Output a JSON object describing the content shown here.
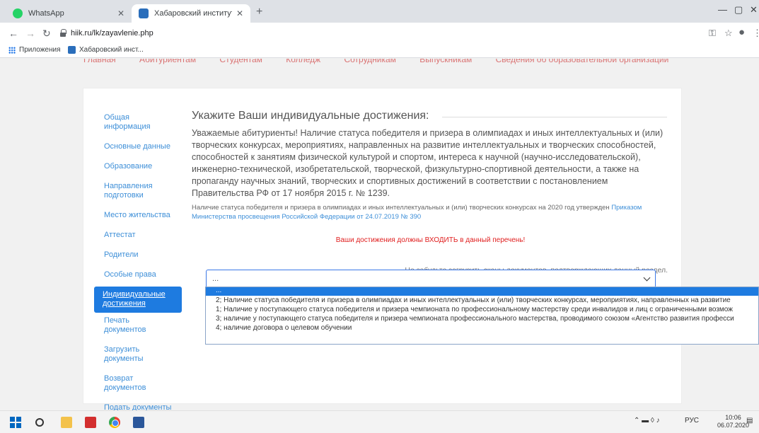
{
  "browser": {
    "tabs": [
      {
        "title": "WhatsApp",
        "favicon": "whatsapp-icon"
      },
      {
        "title": "Хабаровский институт инфокоммуникаций",
        "favicon": "hiik-icon",
        "active": true
      }
    ],
    "url": "hiik.ru/lk/zayavlenie.php",
    "bookmarks": [
      {
        "label": "Приложения",
        "icon": "apps-grid-icon"
      },
      {
        "label": "Хабаровский инст...",
        "icon": "hiik-icon"
      }
    ]
  },
  "site_nav": [
    "Главная",
    "Абитуриентам",
    "Студентам",
    "Колледж",
    "Сотрудникам",
    "Выпускникам",
    "Сведения об образовательной организации"
  ],
  "sidebar": {
    "items": [
      {
        "label": "Общая информация"
      },
      {
        "label": "Основные данные"
      },
      {
        "label": "Образование"
      },
      {
        "label": "Направления подготовки"
      },
      {
        "label": "Место жительства"
      },
      {
        "label": "Аттестат"
      },
      {
        "label": "Родители"
      },
      {
        "label": "Особые права"
      },
      {
        "label": "Индивидуальные достижения",
        "active": true
      },
      {
        "label": "Печать документов"
      },
      {
        "label": "Загрузить документы"
      },
      {
        "label": "Возврат документов"
      },
      {
        "label": "Подать документы"
      }
    ]
  },
  "main": {
    "legend": "Укажите Ваши индивидуальные достижения:",
    "lead": "Уважаемые абитуриенты! Наличие статуса победителя и призера в олимпиадах и иных интеллектуальных и (или) творческих конкурсах, мероприятиях, направленных на развитие интеллектуальных и творческих способностей, способностей к занятиям физической культурой и спортом, интереса к научной (научно-исследовательской), инженерно-технической, изобретательской, творческой, физкультурно-спортивной деятельности, а также на пропаганду научных знаний, творческих и спортивных достижений в соответствии с постановлением Правительства РФ от 17 ноября 2015 г. № 1239.",
    "note_text": "Наличие статуса победителя и призера в олимпиадах и иных интеллектуальных и (или) творческих конкурсах на 2020 год утвержден",
    "note_link": "Приказом Министерства просвещения Российской Федерации от 24.07.2019 № 390",
    "warning": "Ваши достижения должны ВХОДИТЬ в данный перечень!",
    "hint": "Не забудьте загрузить сканы документов, подтверждающих данный раздел.",
    "select_value": "...",
    "options": [
      "...",
      "2; Наличие статуса победителя и призера в олимпиадах и иных интеллектуальных и (или) творческих конкурсах, мероприятиях, направленных на развитие",
      "1; Наличие у поступающего статуса победителя и призера чемпионата по профессиональному мастерству среди инвалидов и лиц с ограниченными возмож",
      "3; наличие у поступающего статуса победителя и призера чемпионата профессионального мастерства, проводимого союзом «Агентство развития професси",
      "4; наличие договора о целевом обучении"
    ]
  },
  "taskbar": {
    "tray_lang": "РУС",
    "time": "10:06",
    "date": "06.07.2020"
  },
  "colors": {
    "accent": "#1e7be0",
    "link": "#3e8fd8",
    "warning": "#e02020"
  }
}
